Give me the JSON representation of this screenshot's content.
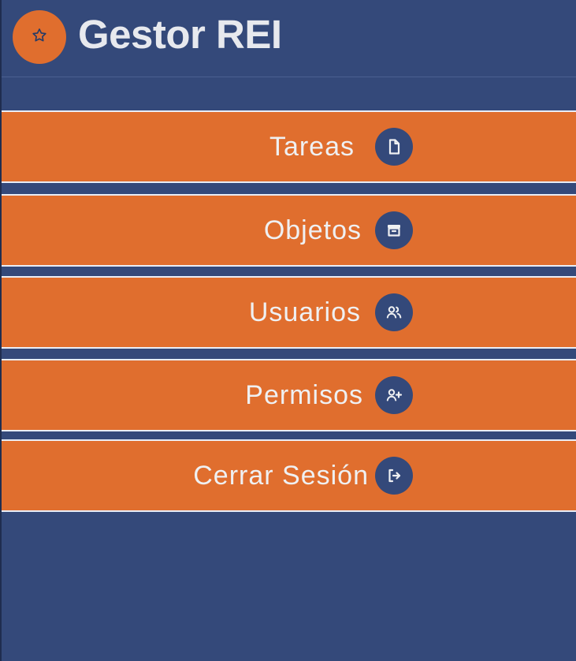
{
  "header": {
    "logo_icon": "star-icon",
    "title": "Gestor REI"
  },
  "colors": {
    "background": "#34497a",
    "accent": "#e06e2e",
    "text": "#eff0f2"
  },
  "menu": {
    "items": [
      {
        "label": "Tareas",
        "icon": "file-icon"
      },
      {
        "label": "Objetos",
        "icon": "archive-icon"
      },
      {
        "label": "Usuarios",
        "icon": "users-icon"
      },
      {
        "label": "Permisos",
        "icon": "user-plus-icon"
      },
      {
        "label": "Cerrar Sesión",
        "icon": "logout-icon"
      }
    ]
  }
}
